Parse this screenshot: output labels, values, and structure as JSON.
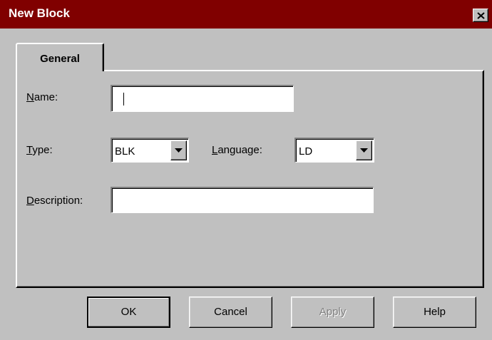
{
  "window": {
    "title": "New Block",
    "close_icon": "close-icon"
  },
  "tabs": [
    {
      "label": "General",
      "active": true
    }
  ],
  "form": {
    "name": {
      "label": "Name:",
      "value": ""
    },
    "type": {
      "label": "Type:",
      "value": "BLK"
    },
    "language": {
      "label": "Language:",
      "value": "LD"
    },
    "description": {
      "label": "Description:",
      "value": ""
    }
  },
  "buttons": {
    "ok": "OK",
    "cancel": "Cancel",
    "apply": "Apply",
    "help": "Help"
  },
  "colors": {
    "titlebar": "#800000",
    "face": "#c0c0c0",
    "field": "#ffffff",
    "disabled_text": "#808080"
  }
}
